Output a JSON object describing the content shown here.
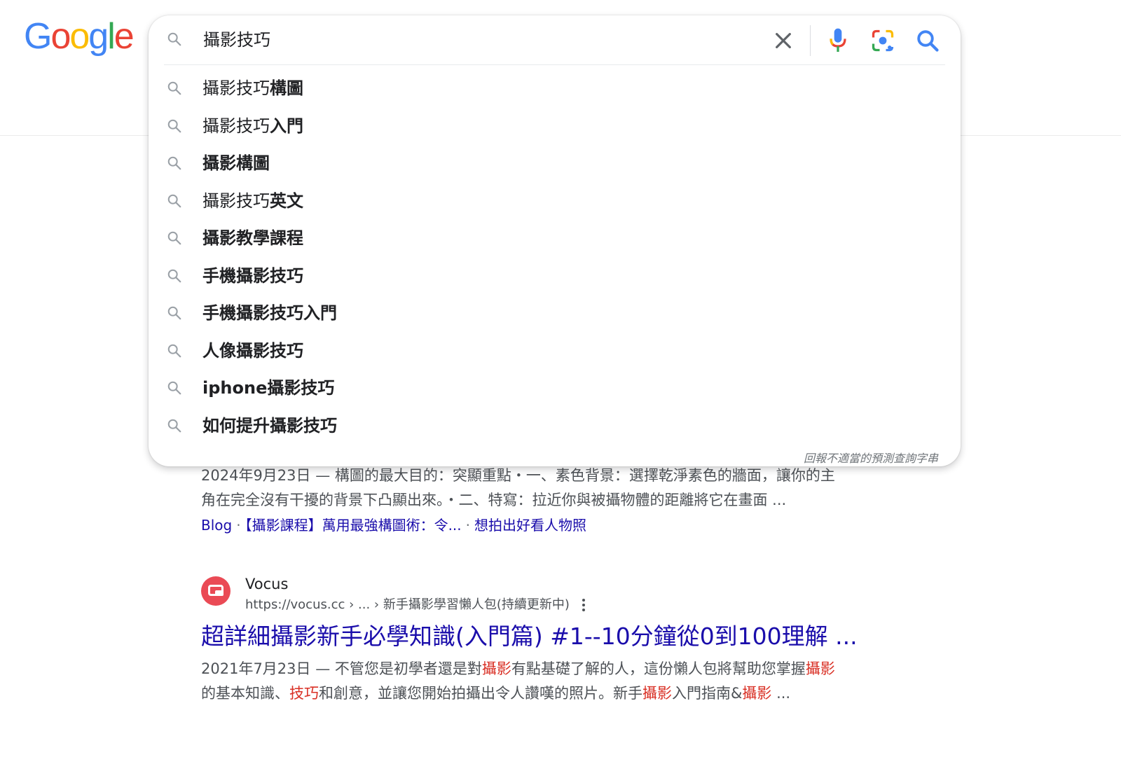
{
  "logo": {
    "letters": [
      "G",
      "o",
      "o",
      "g",
      "l",
      "e"
    ],
    "colors": [
      "#4285f4",
      "#ea4335",
      "#fbbc05",
      "#4285f4",
      "#34a853",
      "#ea4335"
    ]
  },
  "search": {
    "query": "攝影技巧"
  },
  "suggestions": [
    {
      "plain": "攝影技巧",
      "bold": "構圖"
    },
    {
      "plain": "攝影技巧",
      "bold": "入門"
    },
    {
      "plain": "",
      "bold": "攝影構圖"
    },
    {
      "plain": "攝影技巧",
      "bold": "英文"
    },
    {
      "plain": "",
      "bold": "攝影教學課程"
    },
    {
      "plain": "",
      "bold": "手機攝影技巧"
    },
    {
      "plain": "",
      "bold": "手機攝影技巧入門"
    },
    {
      "plain": "",
      "bold": "人像攝影技巧"
    },
    {
      "plain": "",
      "bold": "iphone攝影技巧"
    },
    {
      "plain": "",
      "bold": "如何提升攝影技巧"
    }
  ],
  "report_text": "回報不適當的預測查詢字串",
  "result1": {
    "snippet_line1": "2024年9月23日 — 構圖的最大目的：突顯重點・一、素色背景：選擇乾淨素色的牆面，讓你的主",
    "snippet_line2": "角在完全沒有干擾的背景下凸顯出來。・二、特寫：拉近你與被攝物體的距離將它在畫面 ...",
    "sitelinks": [
      "Blog",
      "【攝影課程】萬用最強構圖術：令...",
      "想拍出好看人物照"
    ]
  },
  "result2": {
    "site_name": "Vocus",
    "url": "https://vocus.cc › ... › 新手攝影學習懶人包(持續更新中)",
    "title": "超詳細攝影新手必學知識(入門篇) #1--10分鐘從0到100理解 ...",
    "snippet_line1": [
      {
        "t": "2021年7月23日 — 不管您是初學者還是對",
        "hl": false
      },
      {
        "t": "攝影",
        "hl": true
      },
      {
        "t": "有點基礎了解的人，這份懶人包將幫助您掌握",
        "hl": false
      },
      {
        "t": "攝影",
        "hl": true
      }
    ],
    "snippet_line2": [
      {
        "t": "的基本知識、",
        "hl": false
      },
      {
        "t": "技巧",
        "hl": true
      },
      {
        "t": "和創意，並讓您開始拍攝出令人讚嘆的照片。新手",
        "hl": false
      },
      {
        "t": "攝影",
        "hl": true
      },
      {
        "t": "入門指南&",
        "hl": false
      },
      {
        "t": "攝影",
        "hl": true
      },
      {
        "t": " ...",
        "hl": false
      }
    ]
  }
}
